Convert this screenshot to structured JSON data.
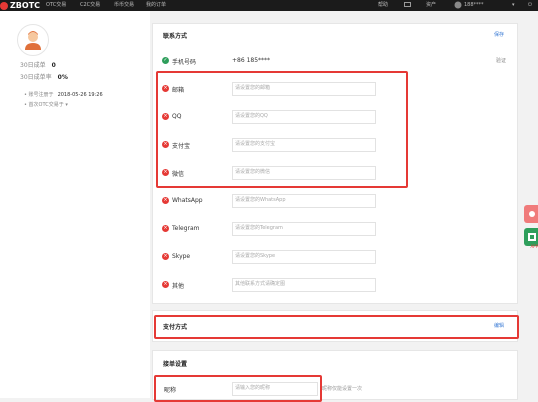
{
  "brand": {
    "logo_text": "ZBOTC"
  },
  "topnav": {
    "left": [
      "OTC交易",
      "C2C交易",
      "币币交易",
      "我的订单"
    ],
    "right": [
      "帮助",
      "",
      "资产",
      "188****"
    ]
  },
  "profile": {
    "stats": [
      {
        "label": "30日成单",
        "value": "0"
      },
      {
        "label": "30日成单率",
        "value": "0%"
      }
    ],
    "meta": [
      {
        "label": "账号注册于",
        "value": "2018-05-26 19:26"
      },
      {
        "label": "首次OTC交易于",
        "value": ""
      }
    ]
  },
  "contact": {
    "title": "联系方式",
    "save_label": "保存",
    "phone": {
      "label": "手机号码",
      "value": "+86 185****",
      "status_text": "验证"
    },
    "fields": [
      {
        "label": "邮箱",
        "placeholder": "请设置您的邮箱"
      },
      {
        "label": "QQ",
        "placeholder": "请设置您的QQ"
      },
      {
        "label": "支付宝",
        "placeholder": "请设置您的支付宝"
      },
      {
        "label": "微信",
        "placeholder": "请设置您的微信"
      },
      {
        "label": "WhatsApp",
        "placeholder": "请设置您的WhatsApp"
      },
      {
        "label": "Telegram",
        "placeholder": "请设置您的Telegram"
      },
      {
        "label": "Skype",
        "placeholder": "请设置您的Skype"
      },
      {
        "label": "其他",
        "placeholder": "其他联系方式请确定图"
      }
    ]
  },
  "payment": {
    "title": "支付方式",
    "edit_label": "编辑"
  },
  "order_settings": {
    "title": "接单设置",
    "nickname": {
      "label": "昵称",
      "placeholder": "请输入您的昵称",
      "hint": "昵称仅能设置一次"
    }
  },
  "colors": {
    "accent_red": "#e53935",
    "verified_green": "#2e9e5b",
    "link_blue": "#3a7bd5"
  }
}
